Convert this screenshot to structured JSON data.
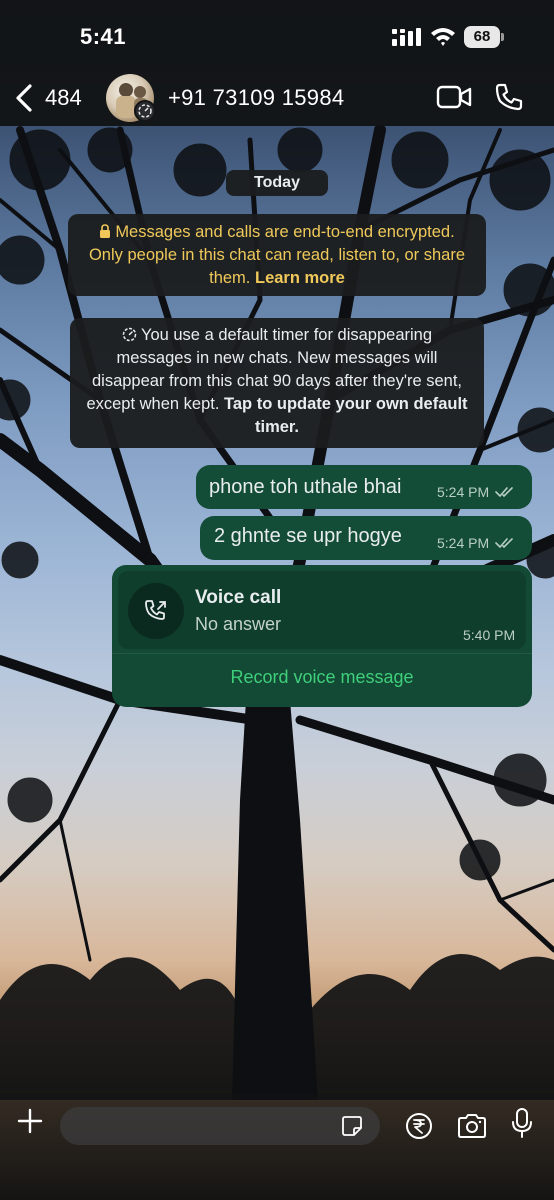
{
  "status_bar": {
    "time": "5:41",
    "battery": "68"
  },
  "header": {
    "back_count": "484",
    "contact": "+91 73109 15984"
  },
  "chat": {
    "date_chip": "Today",
    "encryption_notice": {
      "text": "Messages and calls are end-to-end encrypted. Only people in this chat can read, listen to, or share them.",
      "link": "Learn more"
    },
    "timer_notice": {
      "text": "You use a default timer for disappearing messages in new chats. New messages will disappear from this chat 90 days after they're sent, except when kept.",
      "link": "Tap to update your own default timer."
    },
    "messages": [
      {
        "text": "phone toh uthale bhai",
        "time": "5:24 PM",
        "status": "read-ticks-icon"
      },
      {
        "text": "2 ghnte se upr hogye",
        "time": "5:24 PM",
        "status": "read-ticks-icon"
      }
    ],
    "call": {
      "title": "Voice call",
      "subtitle": "No answer",
      "time": "5:40 PM",
      "action": "Record voice message"
    }
  },
  "composer": {
    "placeholder": "",
    "icons": [
      "plus-icon",
      "sticker-icon",
      "rupee-icon",
      "camera-icon",
      "mic-icon"
    ]
  },
  "colors": {
    "header_bg": "#121416",
    "bubble_out": "#144d37",
    "notice_bg": "#1a1c1e",
    "encryption_text": "#f0c95a",
    "link_green": "#3fcf7a"
  }
}
